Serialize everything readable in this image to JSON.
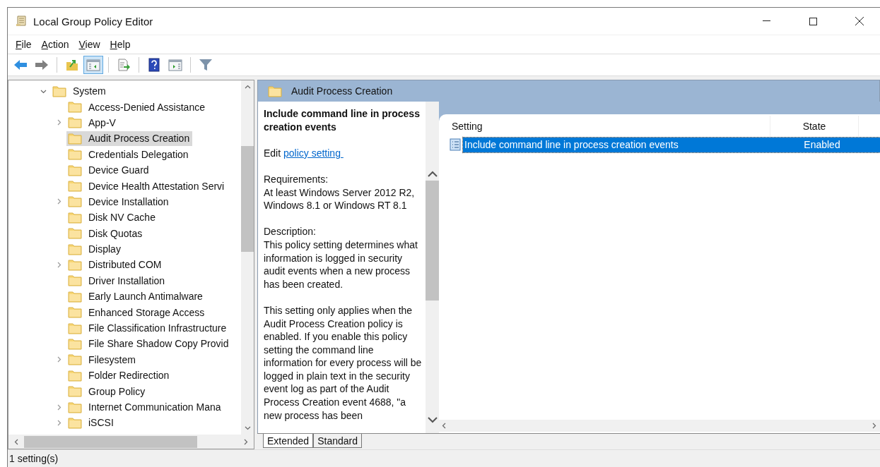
{
  "window": {
    "title": "Local Group Policy Editor"
  },
  "menu": [
    {
      "label": "File"
    },
    {
      "label": "Action"
    },
    {
      "label": "View"
    },
    {
      "label": "Help"
    }
  ],
  "toolbar": [
    {
      "kind": "back",
      "pressed": false
    },
    {
      "kind": "forward",
      "pressed": false
    },
    {
      "kind": "sep"
    },
    {
      "kind": "up",
      "pressed": false
    },
    {
      "kind": "tree",
      "pressed": true
    },
    {
      "kind": "sep"
    },
    {
      "kind": "export",
      "pressed": false
    },
    {
      "kind": "sep"
    },
    {
      "kind": "help",
      "pressed": false
    },
    {
      "kind": "pane",
      "pressed": false
    },
    {
      "kind": "sep"
    },
    {
      "kind": "filter",
      "pressed": false
    }
  ],
  "tree": {
    "items": [
      {
        "label": "System",
        "expandable": true,
        "expanded": true,
        "selected": false,
        "children": [
          {
            "label": "Access-Denied Assistance",
            "expandable": false,
            "expanded": false,
            "selected": false
          },
          {
            "label": "App-V",
            "expandable": true,
            "expanded": false,
            "selected": false
          },
          {
            "label": "Audit Process Creation",
            "expandable": false,
            "expanded": false,
            "selected": true
          },
          {
            "label": "Credentials Delegation",
            "expandable": false,
            "expanded": false,
            "selected": false
          },
          {
            "label": "Device Guard",
            "expandable": false,
            "expanded": false,
            "selected": false
          },
          {
            "label": "Device Health Attestation Servi",
            "expandable": false,
            "expanded": false,
            "selected": false
          },
          {
            "label": "Device Installation",
            "expandable": true,
            "expanded": false,
            "selected": false
          },
          {
            "label": "Disk NV Cache",
            "expandable": false,
            "expanded": false,
            "selected": false
          },
          {
            "label": "Disk Quotas",
            "expandable": false,
            "expanded": false,
            "selected": false
          },
          {
            "label": "Display",
            "expandable": false,
            "expanded": false,
            "selected": false
          },
          {
            "label": "Distributed COM",
            "expandable": true,
            "expanded": false,
            "selected": false
          },
          {
            "label": "Driver Installation",
            "expandable": false,
            "expanded": false,
            "selected": false
          },
          {
            "label": "Early Launch Antimalware",
            "expandable": false,
            "expanded": false,
            "selected": false
          },
          {
            "label": "Enhanced Storage Access",
            "expandable": false,
            "expanded": false,
            "selected": false
          },
          {
            "label": "File Classification Infrastructure",
            "expandable": false,
            "expanded": false,
            "selected": false
          },
          {
            "label": "File Share Shadow Copy Provid",
            "expandable": false,
            "expanded": false,
            "selected": false
          },
          {
            "label": "Filesystem",
            "expandable": true,
            "expanded": false,
            "selected": false
          },
          {
            "label": "Folder Redirection",
            "expandable": false,
            "expanded": false,
            "selected": false
          },
          {
            "label": "Group Policy",
            "expandable": false,
            "expanded": false,
            "selected": false
          },
          {
            "label": "Internet Communication Mana",
            "expandable": true,
            "expanded": false,
            "selected": false
          },
          {
            "label": "iSCSI",
            "expandable": true,
            "expanded": false,
            "selected": false
          }
        ]
      }
    ]
  },
  "details": {
    "header": "Audit Process Creation",
    "title": "Include command line in process creation events",
    "edit_prefix": "Edit",
    "edit_link": "policy setting",
    "requirements_label": "Requirements:",
    "requirements": "At least Windows Server 2012 R2, Windows 8.1 or Windows RT 8.1",
    "description_label": "Description:",
    "paragraphs": [
      "This policy setting determines what information is logged in security audit events when a new process has been created.",
      "This setting only applies when the Audit Process Creation policy is enabled. If you enable this policy setting the command line information for every process will be logged in plain text in the security event log as part of the Audit Process Creation event 4688, \"a new process has been"
    ]
  },
  "tabs": [
    {
      "label": "Extended",
      "selected": true
    },
    {
      "label": "Standard",
      "selected": false
    }
  ],
  "settings": {
    "columns": [
      "Setting",
      "State"
    ],
    "rows": [
      {
        "setting": "Include command line in process creation events",
        "state": "Enabled",
        "selected": true
      }
    ]
  },
  "status_bar": "1 setting(s)"
}
